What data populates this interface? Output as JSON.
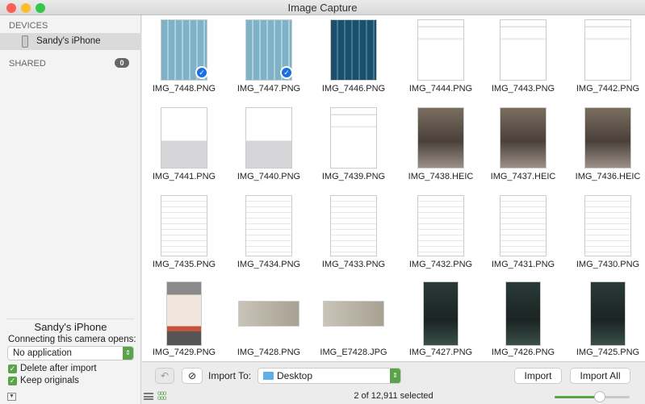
{
  "window": {
    "title": "Image Capture"
  },
  "sidebar": {
    "devices_header": "DEVICES",
    "device_name": "Sandy's iPhone",
    "shared_header": "SHARED",
    "shared_count": "0",
    "panel_device_name": "Sandy's iPhone",
    "connect_label": "Connecting this camera opens:",
    "connect_value": "No application",
    "delete_after_import": {
      "label": "Delete after import",
      "checked": true
    },
    "keep_originals": {
      "label": "Keep originals",
      "checked": true
    }
  },
  "images": [
    {
      "name": "IMG_7448.PNG",
      "kind": "keyboard-light",
      "selected": true
    },
    {
      "name": "IMG_7447.PNG",
      "kind": "keyboard-light",
      "selected": true
    },
    {
      "name": "IMG_7446.PNG",
      "kind": "keyboard-dark",
      "selected": false
    },
    {
      "name": "IMG_7444.PNG",
      "kind": "doc",
      "selected": false
    },
    {
      "name": "IMG_7443.PNG",
      "kind": "doc",
      "selected": false
    },
    {
      "name": "IMG_7442.PNG",
      "kind": "doc",
      "selected": false
    },
    {
      "name": "IMG_7441.PNG",
      "kind": "doc-keyboard",
      "selected": false
    },
    {
      "name": "IMG_7440.PNG",
      "kind": "doc-keyboard",
      "selected": false
    },
    {
      "name": "IMG_7439.PNG",
      "kind": "doc",
      "selected": false
    },
    {
      "name": "IMG_7438.HEIC",
      "kind": "photo",
      "selected": false
    },
    {
      "name": "IMG_7437.HEIC",
      "kind": "photo",
      "selected": false
    },
    {
      "name": "IMG_7436.HEIC",
      "kind": "photo",
      "selected": false
    },
    {
      "name": "IMG_7435.PNG",
      "kind": "list",
      "selected": false
    },
    {
      "name": "IMG_7434.PNG",
      "kind": "list",
      "selected": false
    },
    {
      "name": "IMG_7433.PNG",
      "kind": "list",
      "selected": false
    },
    {
      "name": "IMG_7432.PNG",
      "kind": "list",
      "selected": false
    },
    {
      "name": "IMG_7431.PNG",
      "kind": "list",
      "selected": false
    },
    {
      "name": "IMG_7430.PNG",
      "kind": "list",
      "selected": false
    },
    {
      "name": "IMG_7429.PNG",
      "kind": "dialog",
      "selected": false
    },
    {
      "name": "IMG_7428.PNG",
      "kind": "landscape",
      "selected": false
    },
    {
      "name": "IMG_E7428.JPG",
      "kind": "landscape",
      "selected": false
    },
    {
      "name": "IMG_7427.PNG",
      "kind": "dark-app",
      "selected": false
    },
    {
      "name": "IMG_7426.PNG",
      "kind": "dark-app",
      "selected": false
    },
    {
      "name": "IMG_7425.PNG",
      "kind": "dark-app",
      "selected": false
    }
  ],
  "toolbar": {
    "import_to_label": "Import To:",
    "destination": "Desktop",
    "import_label": "Import",
    "import_all_label": "Import All"
  },
  "status": {
    "text": "2 of 12,911 selected",
    "thumbnail_size_percent": 60
  },
  "colors": {
    "accent": "#5aa34a",
    "selection": "#1b6fe0"
  }
}
